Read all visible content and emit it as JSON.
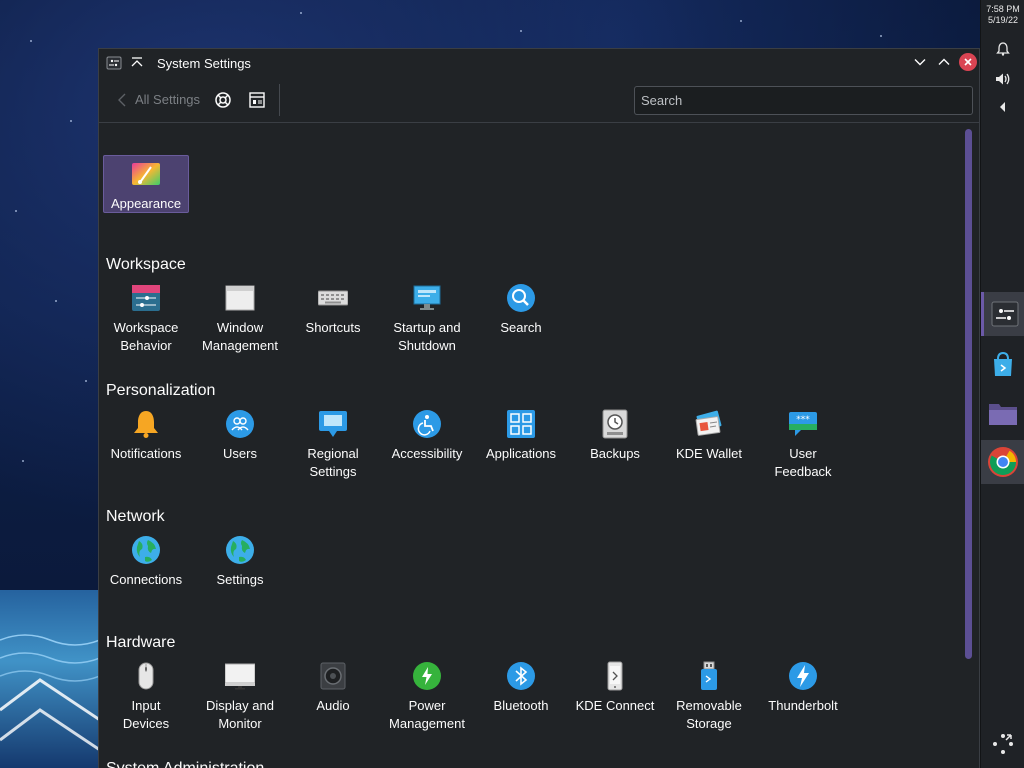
{
  "clock": {
    "time": "7:58 PM",
    "date": "5/19/22"
  },
  "window": {
    "title": "System Settings"
  },
  "toolbar": {
    "back_label": "All Settings",
    "search_placeholder": "Search"
  },
  "top_item": {
    "label": "Appearance",
    "icon": "appearance-icon"
  },
  "sections": {
    "workspace": {
      "title": "Workspace",
      "items": [
        "Workspace\nBehavior",
        "Window\nManagement",
        "Shortcuts",
        "Startup and\nShutdown",
        "Search"
      ]
    },
    "personalization": {
      "title": "Personalization",
      "items": [
        "Notifications",
        "Users",
        "Regional\nSettings",
        "Accessibility",
        "Applications",
        "Backups",
        "KDE Wallet",
        "User\nFeedback"
      ]
    },
    "network": {
      "title": "Network",
      "items": [
        "Connections",
        "Settings"
      ]
    },
    "hardware": {
      "title": "Hardware",
      "items": [
        "Input\nDevices",
        "Display and\nMonitor",
        "Audio",
        "Power\nManagement",
        "Bluetooth",
        "KDE Connect",
        "Removable\nStorage",
        "Thunderbolt"
      ]
    },
    "system_admin": {
      "title": "System Administration"
    }
  },
  "colors": {
    "accent": "#6c5aa8",
    "selection": "#4c4270",
    "window_bg": "#202326",
    "close": "#da4453"
  }
}
